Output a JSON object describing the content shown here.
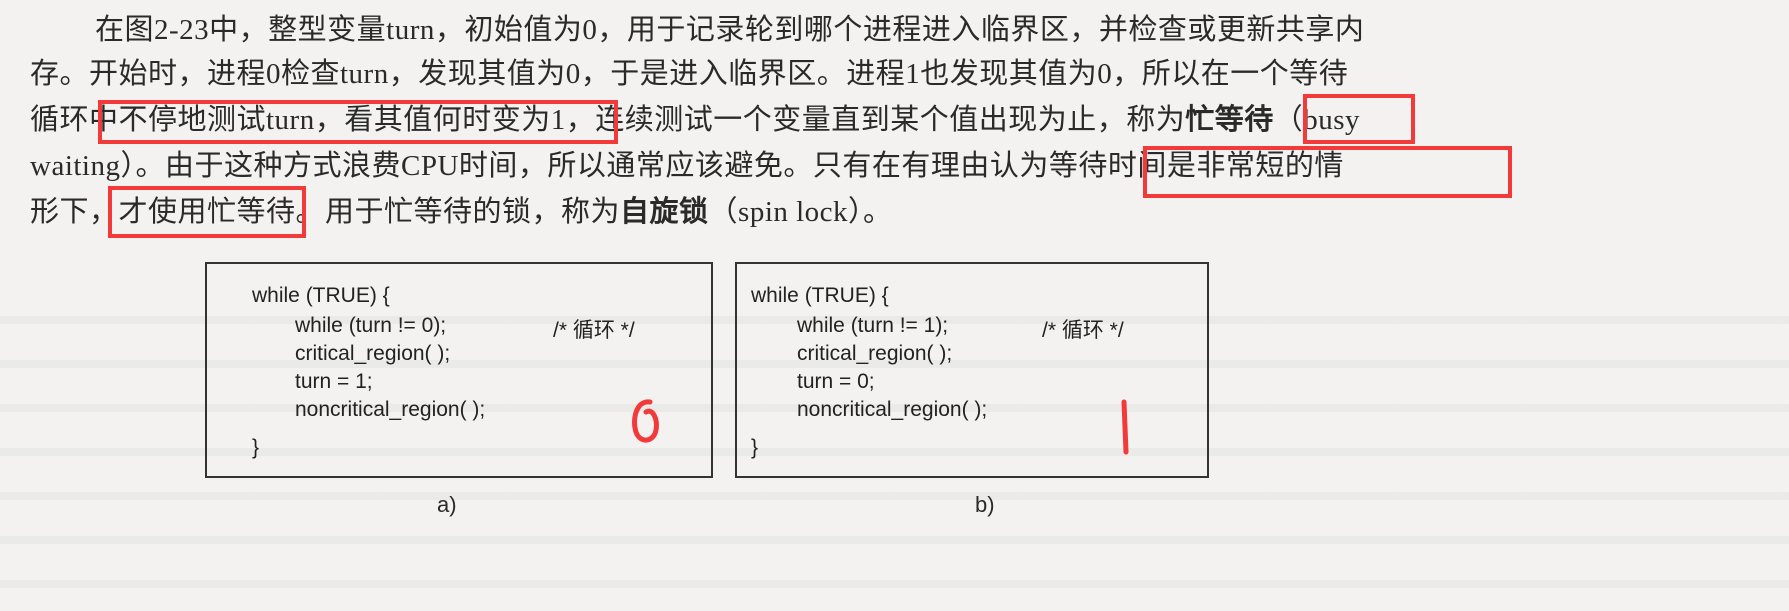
{
  "paragraph": {
    "lines": [
      "在图2-23中，整型变量turn，初始值为0，用于记录轮到哪个进程进入临界区，并检查或更新共享内",
      "存。开始时，进程0检查turn，发现其值为0，于是进入临界区。进程1也发现其值为0，所以在一个等待",
      "循环中不停地测试turn，看其值何时变为1，连续测试一个变量直到某个值出现为止，称为",
      "waiting）。由于这种方式浪费CPU时间，所以通常应该避免。只有在有理由认为等待时间是非常短的情",
      "形下，才使用忙等待。用于忙等待的锁，称为",
      "（spin lock）。"
    ],
    "term_busy_waiting": "忙等待",
    "term_busy_suffix": "（busy",
    "term_spin_lock": "自旋锁"
  },
  "highlights": [
    "不停地测试turn，看其值何时变为1",
    "忙等待",
    "等待时间是非常短的情",
    "才使用忙等待"
  ],
  "annotation_color": "#f23a3a",
  "figure": {
    "a": {
      "caption": "a)",
      "code": [
        "while (TRUE) {",
        "while (turn != 0);",
        "critical_region( );",
        "turn = 1;",
        "noncritical_region( );",
        "}"
      ],
      "comment": "/* 循环 */"
    },
    "b": {
      "caption": "b)",
      "code": [
        "while (TRUE) {",
        "while (turn != 1);",
        "critical_region( );",
        "turn = 0;",
        "noncritical_region( );",
        "}"
      ],
      "comment": "/* 循环 */"
    }
  }
}
